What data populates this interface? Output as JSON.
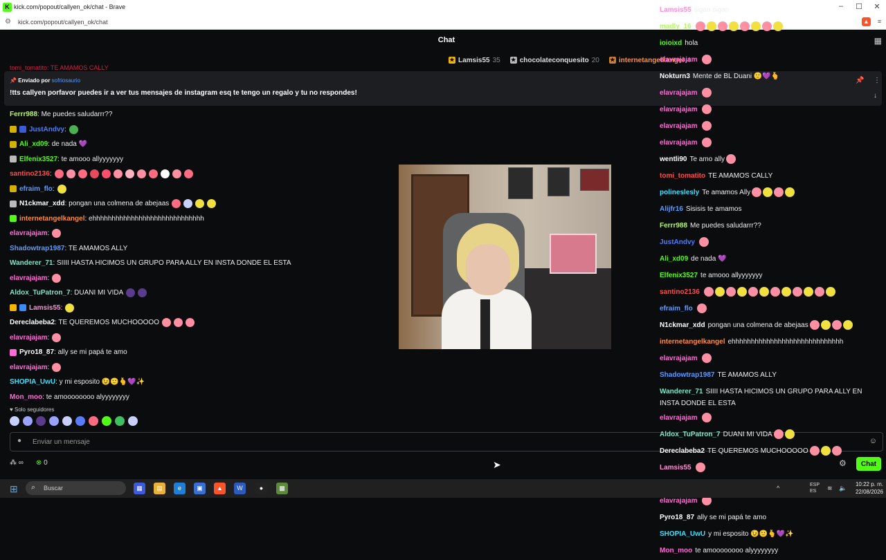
{
  "window": {
    "title": "kick.com/popout/callyen_ok/chat - Brave",
    "url": "kick.com/popout/callyen_ok/chat"
  },
  "chat": {
    "title": "Chat",
    "leaderboard": [
      {
        "name": "Lamsis55",
        "count": "35",
        "color": "#f5b400"
      },
      {
        "name": "chocolateconquesito",
        "count": "20",
        "color": "#b9b9b9"
      },
      {
        "name": "internetangelkangel",
        "count": "4",
        "color": "#cd7f32"
      }
    ],
    "partial_top": "tomi_tomatito: TE AMAMOS CALLY",
    "pinned": {
      "prefix": "Enviado por",
      "user": "sofriosaurio",
      "message": "!tts callyen porfavor puedes ir a ver tus mensajes de instagram esq te tengo un regalo y tu no respondes!"
    },
    "messages": [
      {
        "user": "Ferrr988",
        "color": "#b6f36b",
        "text": ": Me puedes saludarrr??",
        "badges": [],
        "emotes": []
      },
      {
        "user": "JustAndvy",
        "color": "#4a7dff",
        "text": ":",
        "badges": [
          "#d4b000",
          "#3b5bdb"
        ],
        "emotes": [
          "#4caf50"
        ]
      },
      {
        "user": "Ali_xd09",
        "color": "#53fc18",
        "text": ": de nada 💜",
        "badges": [
          "#d4b000"
        ],
        "emotes": []
      },
      {
        "user": "Elfenix3527",
        "color": "#53fc18",
        "text": ": te amooo allyyyyyyy",
        "badges": [
          "#bbbbbb"
        ],
        "emotes": []
      },
      {
        "user": "santino2136",
        "color": "#ff4d4d",
        "text": ":",
        "badges": [],
        "emotes": [
          "#ff6b81",
          "#ff8fa3",
          "#ff6b81",
          "#e64a5c",
          "#ff4d6d",
          "#ff8fa3",
          "#ffb3c1",
          "#ff8fa3",
          "#ff6b81",
          "#ffffff",
          "#ff8fa3",
          "#ff6b81"
        ]
      },
      {
        "user": "efraim_flo",
        "color": "#5b9bff",
        "text": ":",
        "badges": [
          "#d4b000"
        ],
        "emotes": [
          "#f0e040"
        ]
      },
      {
        "user": "N1ckmar_xdd",
        "color": "#ffffff",
        "text": ": pongan una colmena de abejaas",
        "badges": [
          "#bbbbbb"
        ],
        "emotes": [
          "#ff6b81",
          "#c8d0ff",
          "#f0e040",
          "#f0e040"
        ]
      },
      {
        "user": "internetangelkangel",
        "color": "#ff8c42",
        "text": ": ehhhhhhhhhhhhhhhhhhhhhhhhhhhhh",
        "badges": [
          "#53fc18"
        ],
        "emotes": []
      },
      {
        "user": "elavrajajam",
        "color": "#ff6bd6",
        "text": ":",
        "badges": [],
        "emotes": [
          "#ff8fa3"
        ]
      },
      {
        "user": "Shadowtrap1987",
        "color": "#5b9bff",
        "text": ": TE AMAMOS ALLY",
        "badges": [],
        "emotes": []
      },
      {
        "user": "Wanderer_71",
        "color": "#7fe7c4",
        "text": ": SIIII HASTA HICIMOS UN GRUPO PARA ALLY EN INSTA DONDE EL ESTA",
        "badges": [],
        "emotes": []
      },
      {
        "user": "elavrajajam",
        "color": "#ff6bd6",
        "text": ":",
        "badges": [],
        "emotes": [
          "#ff8fa3"
        ]
      },
      {
        "user": "Aldox_TuPatron_7",
        "color": "#7fe7c4",
        "text": ": DUANI MI VIDA",
        "badges": [],
        "emotes": [
          "#5a3b8c",
          "#5a3b8c"
        ]
      },
      {
        "user": "Lamsis55",
        "color": "#ff8fd6",
        "text": ":",
        "badges": [
          "#f5b400",
          "#3b8bff"
        ],
        "emotes": [
          "#f0e040"
        ]
      },
      {
        "user": "Dereclabeba2",
        "color": "#ffffff",
        "text": ": TE QUEREMOS MUCHOOOOO",
        "badges": [],
        "emotes": [
          "#ff8fa3",
          "#ff8fa3",
          "#ff8fa3"
        ]
      },
      {
        "user": "elavrajajam",
        "color": "#ff6bd6",
        "text": ":",
        "badges": [],
        "emotes": [
          "#ff8fa3"
        ]
      },
      {
        "user": "Pyro18_87",
        "color": "#ffffff",
        "text": ": ally se mi papá te amo",
        "badges": [
          "#ff6bd6"
        ],
        "emotes": []
      },
      {
        "user": "elavrajajam",
        "color": "#ff6bd6",
        "text": ":",
        "badges": [],
        "emotes": [
          "#ff8fa3"
        ]
      },
      {
        "user": "SHOPIA_UwU",
        "color": "#3fe0ff",
        "text": ": y mi esposito 😉🙂🫰💜✨",
        "badges": [],
        "emotes": []
      },
      {
        "user": "Mon_moo",
        "color": "#ff6bd6",
        "text": ": te amoooooooo alyyyyyyyy",
        "badges": [],
        "emotes": []
      }
    ],
    "followers_label": "Solo seguidores",
    "emote_bar": [
      "#c8d0ff",
      "#9aa3ff",
      "#5a3b8c",
      "#9aa3ff",
      "#c8d0ff",
      "#5b7bff",
      "#ff6b81",
      "#53fc18",
      "#3fbf5f",
      "#c8d0ff"
    ],
    "input_placeholder": "Enviar un mensaje",
    "footer": {
      "points": "0",
      "chat_button": "Chat"
    }
  },
  "overlay_chat": [
    {
      "user": "Lamsis55",
      "color": "#ff8fd6",
      "text": "sigan sigan",
      "emotes": 0
    },
    {
      "user": "madly_16",
      "color": "#b6f36b",
      "text": "",
      "emotes": 8
    },
    {
      "user": "ioioixd",
      "color": "#53fc18",
      "text": "hola",
      "emotes": 0
    },
    {
      "user": "elavrajajam",
      "color": "#ff6bd6",
      "text": "",
      "emotes": 1
    },
    {
      "user": "Nokturn3",
      "color": "#ffffff",
      "text": "Mente de BL Duani 🙂💜🫰",
      "emotes": 0
    },
    {
      "user": "elavrajajam",
      "color": "#ff6bd6",
      "text": "",
      "emotes": 1
    },
    {
      "user": "elavrajajam",
      "color": "#ff6bd6",
      "text": "",
      "emotes": 1
    },
    {
      "user": "elavrajajam",
      "color": "#ff6bd6",
      "text": "",
      "emotes": 1
    },
    {
      "user": "elavrajajam",
      "color": "#ff6bd6",
      "text": "",
      "emotes": 1
    },
    {
      "user": "wentli90",
      "color": "#ffffff",
      "text": "Te amo ally",
      "emotes": 1
    },
    {
      "user": "tomi_tomatito",
      "color": "#ff4d4d",
      "text": "TE AMAMOS CALLY",
      "emotes": 0
    },
    {
      "user": "polineslesly",
      "color": "#3fe0ff",
      "text": "Te amamos Ally",
      "emotes": 4
    },
    {
      "user": "Alijfr16",
      "color": "#5b9bff",
      "text": "Sisisis te amamos",
      "emotes": 0
    },
    {
      "user": "Ferrr988",
      "color": "#b6f36b",
      "text": "Me puedes saludarrr??",
      "emotes": 0
    },
    {
      "user": "JustAndvy",
      "color": "#4a7dff",
      "text": "",
      "emotes": 1
    },
    {
      "user": "Ali_xd09",
      "color": "#53fc18",
      "text": "de nada 💜",
      "emotes": 0
    },
    {
      "user": "Elfenix3527",
      "color": "#53fc18",
      "text": "te amooo allyyyyyyy",
      "emotes": 0
    },
    {
      "user": "santino2136",
      "color": "#ff4d4d",
      "text": "",
      "emotes": 12
    },
    {
      "user": "efraim_flo",
      "color": "#5b9bff",
      "text": "",
      "emotes": 1
    },
    {
      "user": "N1ckmar_xdd",
      "color": "#ffffff",
      "text": "pongan una colmena de abejaas",
      "emotes": 4
    },
    {
      "user": "internetangelkangel",
      "color": "#ff8c42",
      "text": "ehhhhhhhhhhhhhhhhhhhhhhhhhhhhh",
      "emotes": 0
    },
    {
      "user": "elavrajajam",
      "color": "#ff6bd6",
      "text": "",
      "emotes": 1
    },
    {
      "user": "Shadowtrap1987",
      "color": "#5b9bff",
      "text": "TE AMAMOS ALLY",
      "emotes": 0
    },
    {
      "user": "Wanderer_71",
      "color": "#7fe7c4",
      "text": "SIIII HASTA HICIMOS UN GRUPO PARA ALLY EN INSTA DONDE EL ESTA",
      "emotes": 0
    },
    {
      "user": "elavrajajam",
      "color": "#ff6bd6",
      "text": "",
      "emotes": 1
    },
    {
      "user": "Aldox_TuPatron_7",
      "color": "#7fe7c4",
      "text": "DUANI MI VIDA",
      "emotes": 2
    },
    {
      "user": "Dereclabeba2",
      "color": "#ffffff",
      "text": "TE QUEREMOS MUCHOOOOO",
      "emotes": 3
    },
    {
      "user": "Lamsis55",
      "color": "#ff8fd6",
      "text": "",
      "emotes": 1
    },
    {
      "user": "elavrajajam",
      "color": "#ff6bd6",
      "text": "",
      "emotes": 1
    },
    {
      "user": "elavrajajam",
      "color": "#ff6bd6",
      "text": "",
      "emotes": 1
    },
    {
      "user": "Pyro18_87",
      "color": "#ffffff",
      "text": "ally se mi papá te amo",
      "emotes": 0
    },
    {
      "user": "SHOPIA_UwU",
      "color": "#3fe0ff",
      "text": "y mi esposito 😉🙂🫰💜✨",
      "emotes": 0
    },
    {
      "user": "Mon_moo",
      "color": "#ff6bd6",
      "text": "te amoooooooo alyyyyyyyy",
      "emotes": 0
    }
  ],
  "taskbar": {
    "search_placeholder": "Buscar",
    "lang": "ESP",
    "lang_sub": "ES",
    "time": "10:22 p. m.",
    "date": "22/08/2026"
  }
}
